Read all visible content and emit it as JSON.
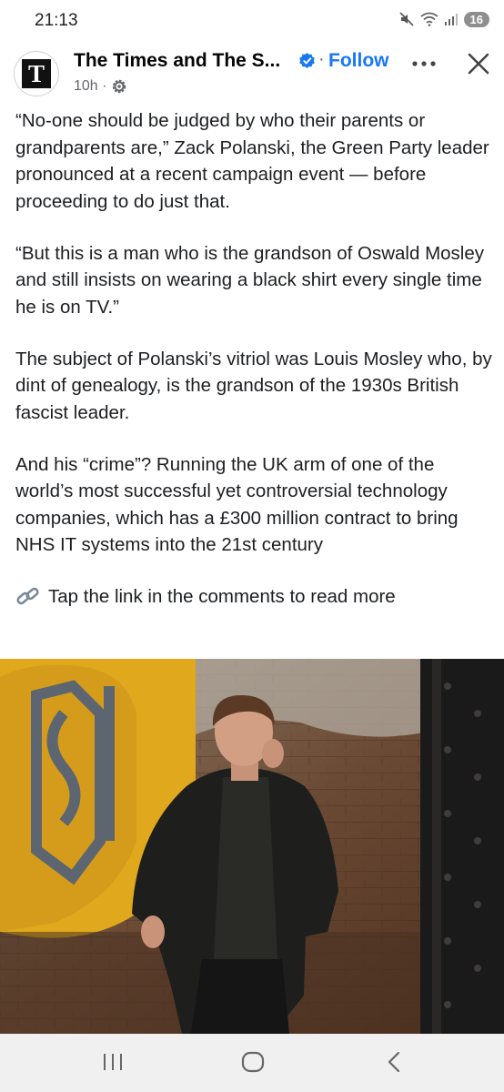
{
  "status_bar": {
    "time": "21:13",
    "battery": "16",
    "icons": [
      "mute-vibrate-icon",
      "wifi-icon",
      "signal-icon"
    ]
  },
  "post": {
    "logo_letter": "T",
    "page_name": "The Times and The S...",
    "follow_label": "Follow",
    "separator": "·",
    "timestamp": "10h ·",
    "paragraphs": [
      "“No-one should be judged by who their parents or grandparents are,” Zack Polanski, the Green Party leader pronounced at a recent campaign event — before proceeding to do just that.",
      "“But this is a man who is the grandson of Oswald Mosley and still insists on wearing a black shirt every single time he is on TV.”",
      "The subject of Polanski’s vitriol was Louis Mosley who, by dint of genealogy, is the grandson of the 1930s British fascist leader.",
      "And his “crime”? Running the UK arm of one of the world’s most successful yet controversial technology companies, which has a £300 million contract to bring NHS IT systems into the 21st century"
    ],
    "link_text": "Tap the link in the comments to read more"
  },
  "colors": {
    "accent": "#1877f2",
    "text": "#1c1e21",
    "secondary": "#65676b",
    "nav_bg": "#f0f0f0"
  }
}
